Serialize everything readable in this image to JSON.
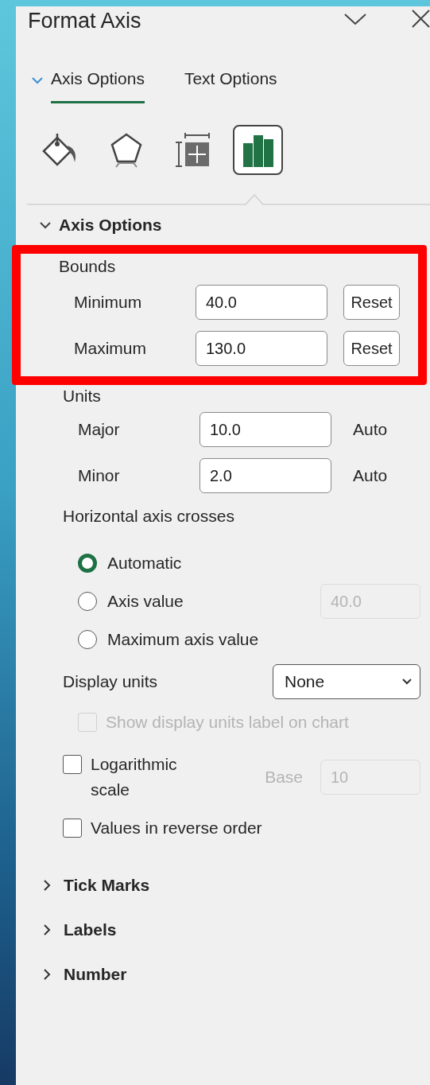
{
  "panel": {
    "title": "Format Axis"
  },
  "tabs": [
    {
      "label": "Axis Options",
      "selected": true
    },
    {
      "label": "Text Options",
      "selected": false
    }
  ],
  "icon_tabs": [
    {
      "kind": "fill",
      "selected": false
    },
    {
      "kind": "effects",
      "selected": false
    },
    {
      "kind": "size",
      "selected": false
    },
    {
      "kind": "axis",
      "selected": true
    }
  ],
  "section": {
    "title": "Axis Options",
    "expanded": true
  },
  "bounds": {
    "label": "Bounds",
    "highlighted": true,
    "rows": [
      {
        "label": "Minimum",
        "value": "40.0",
        "action": "Reset",
        "kind": "button"
      },
      {
        "label": "Maximum",
        "value": "130.0",
        "action": "Reset",
        "kind": "button"
      }
    ]
  },
  "units": {
    "label": "Units",
    "rows": [
      {
        "label": "Major",
        "value": "10.0",
        "action": "Auto",
        "kind": "text"
      },
      {
        "label": "Minor",
        "value": "2.0",
        "action": "Auto",
        "kind": "text"
      }
    ]
  },
  "crosses": {
    "label": "Horizontal axis crosses",
    "options": [
      {
        "label": "Automatic",
        "selected": true
      },
      {
        "label": "Axis value",
        "selected": false,
        "value": "40.0"
      },
      {
        "label": "Maximum axis value",
        "selected": false
      }
    ]
  },
  "display_units": {
    "label": "Display units",
    "value": "None"
  },
  "checkboxes": [
    {
      "kind": "indented",
      "label": "Show display units label on chart",
      "checked": false,
      "disabled": true
    },
    {
      "kind": "with_base",
      "label": "Logarithmic scale",
      "checked": false,
      "disabled": false,
      "base_label": "Base",
      "base_value": "10"
    },
    {
      "kind": "plain",
      "label": "Values in reverse order",
      "checked": false,
      "disabled": false
    }
  ],
  "collapsed_sections": [
    {
      "title": "Tick Marks",
      "expanded": false
    },
    {
      "title": "Labels",
      "expanded": false
    },
    {
      "title": "Number",
      "expanded": false
    }
  ]
}
